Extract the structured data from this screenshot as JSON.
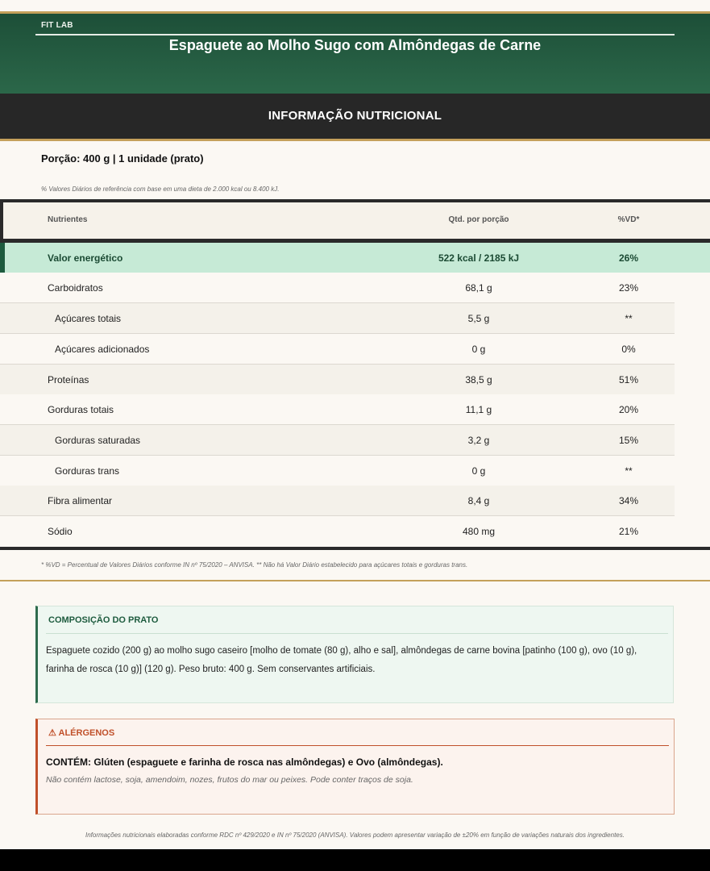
{
  "header": {
    "brand": "FIT LAB",
    "dish_title": "Espaguete ao Molho Sugo com Almôndegas de Carne"
  },
  "nutrition": {
    "section_title": "INFORMAÇÃO NUTRICIONAL",
    "portion": "Porção: 400 g  |  1 unidade (prato)",
    "reference_note": "% Valores Diários de referência com base em uma dieta de 2.000 kcal ou 8.400 kJ.",
    "columns": {
      "name": "Nutrientes",
      "qty": "Qtd. por porção",
      "vd": "%VD*"
    },
    "rows": [
      {
        "name": "Valor energético",
        "qty": "522 kcal / 2185 kJ",
        "vd": "26%"
      },
      {
        "name": "Carboidratos",
        "qty": "68,1 g",
        "vd": "23%"
      },
      {
        "name": "Açúcares totais",
        "qty": "5,5 g",
        "vd": "**"
      },
      {
        "name": "Açúcares adicionados",
        "qty": "0 g",
        "vd": "0%"
      },
      {
        "name": "Proteínas",
        "qty": "38,5 g",
        "vd": "51%"
      },
      {
        "name": "Gorduras totais",
        "qty": "11,1 g",
        "vd": "20%"
      },
      {
        "name": "Gorduras saturadas",
        "qty": "3,2 g",
        "vd": "15%"
      },
      {
        "name": "Gorduras trans",
        "qty": "0 g",
        "vd": "**"
      },
      {
        "name": "Fibra alimentar",
        "qty": "8,4 g",
        "vd": "34%"
      },
      {
        "name": "Sódio",
        "qty": "480 mg",
        "vd": "21%"
      }
    ],
    "footnote": "* %VD = Percentual de Valores Diários conforme IN nº 75/2020 – ANVISA.   ** Não há Valor Diário estabelecido para açúcares totais e gorduras trans."
  },
  "composition": {
    "title": "COMPOSIÇÃO DO PRATO",
    "text": "Espaguete cozido (200 g) ao molho sugo caseiro [molho de tomate (80 g), alho e sal], almôndegas de carne bovina [patinho (100 g), ovo (10 g), farinha de rosca (10 g)] (120 g). Peso bruto: 400 g. Sem conservantes artificiais."
  },
  "allergens": {
    "title": "⚠ ALÉRGENOS",
    "contains": "CONTÉM: Glúten (espaguete e farinha de rosca nas almôndegas) e Ovo (almôndegas).",
    "note": "Não contém lactose, soja, amendoim, nozes, frutos do mar ou peixes. Pode conter traços de soja."
  },
  "legal": "Informações nutricionais elaboradas conforme RDC nº 429/2020 e IN nº 75/2020 (ANVISA). Valores podem apresentar variação de ±20% em função de variações naturais dos ingredientes."
}
